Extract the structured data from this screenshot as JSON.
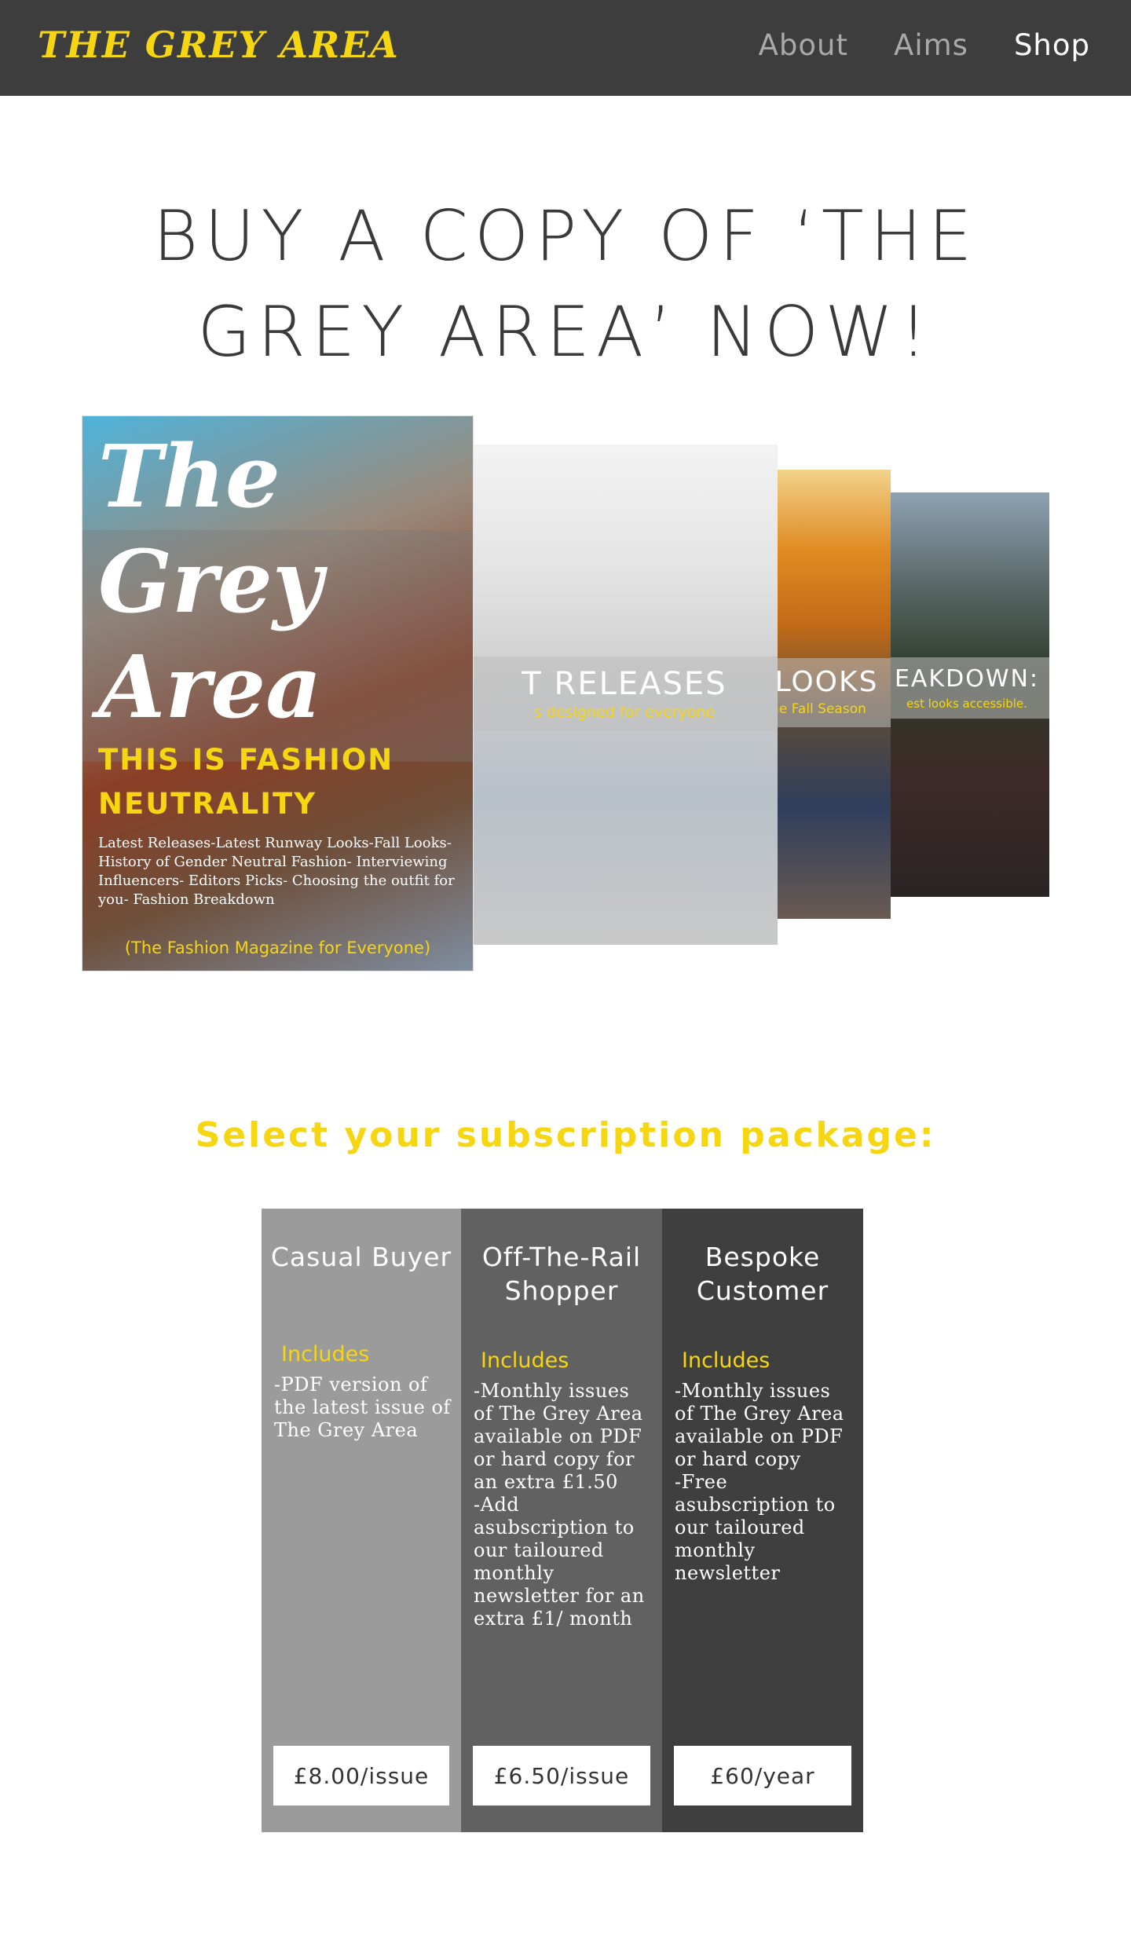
{
  "nav": {
    "brand": "THE GREY AREA",
    "links": [
      "About",
      "Aims",
      "Shop"
    ],
    "active": "Shop"
  },
  "headline": "BUY A COPY OF ‘THE GREY AREA’ NOW!",
  "covers": {
    "main": {
      "title_lines": [
        "The",
        "Grey",
        "Area"
      ],
      "tagline_lines": [
        "THIS IS FASHION",
        "NEUTRALITY"
      ],
      "contents": "Latest Releases-Latest Runway Looks-Fall Looks- History of Gender Neutral Fashion- Interviewing Influencers- Editors Picks- Choosing the outfit for you- Fashion Breakdown",
      "footer": "(The Fashion Magazine for Everyone)"
    },
    "card2": {
      "title": "T RELEASES",
      "subtitle": "s designed for everyone"
    },
    "card3": {
      "title": "NAL LOOKS",
      "subtitle": "oks for the Fall Season"
    },
    "card4": {
      "title": "EAKDOWN:",
      "subtitle": "est looks accessible."
    }
  },
  "subscription": {
    "heading": "Select your subscription package:",
    "plans": [
      {
        "name": "Casual Buyer",
        "includes": "Includes",
        "description": "-PDF version of the latest issue of The Grey Area",
        "price": "£8.00/issue"
      },
      {
        "name": "Off-The-Rail Shopper",
        "includes": "Includes",
        "description": "-Monthly issues of The Grey Area available on PDF or hard copy for an extra £1.50\n-Add asubscription to our tailoured monthly newsletter for an extra £1/ month",
        "price": "£6.50/issue"
      },
      {
        "name": "Bespoke Customer",
        "includes": "Includes",
        "description": "-Monthly issues of The Grey Area available on PDF or hard copy\n-Free asubscription to our tailoured monthly newsletter",
        "price": "£60/year"
      }
    ]
  },
  "colors": {
    "nav_bg": "#3d3d3d",
    "accent_yellow": "#f6d611",
    "plan_light": "#9b9b9b",
    "plan_mid": "#616161",
    "plan_dark": "#3f3f3f"
  }
}
